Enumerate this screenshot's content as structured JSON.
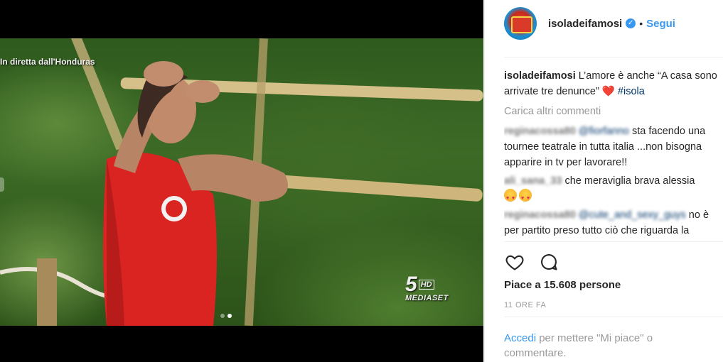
{
  "video": {
    "overlay_text": "In diretta dall'Honduras",
    "logo_number": "5",
    "logo_hd": "HD",
    "logo_name": "MEDIASET",
    "carousel_active": 2,
    "carousel_total": 2
  },
  "post": {
    "username": "isoladeifamosi",
    "verified": true,
    "separator": "•",
    "follow_label": "Segui",
    "caption_user": "isoladeifamosi",
    "caption_text": "L’amore è anche “A casa sono arrivate tre denunce”",
    "caption_heart": "❤️",
    "caption_hashtag": "#isola",
    "load_more": "Carica altri commenti",
    "comments": [
      {
        "user": "reginacossa80",
        "mention": "@fiorfanno",
        "text": "sta facendo una tournee teatrale in tutta italia ...non bisogna apparire in tv per lavorare!!"
      },
      {
        "user": "ali_sana_33",
        "mention": "",
        "text": "che meraviglia brava alessia"
      },
      {
        "user": "reginacossa80",
        "mention": "@cute_and_sexy_guys",
        "text": "no è per partito preso tutto ciò che riguarda la"
      }
    ],
    "likes_text": "Piace a 15.608 persone",
    "time_text": "11 ORE FA",
    "login_link": "Accedi",
    "login_text": " per mettere \"Mi piace\" o commentare."
  },
  "icons": {
    "like": "heart-outline-icon",
    "comment": "comment-bubble-icon",
    "verified": "verified-badge-icon"
  },
  "colors": {
    "link": "#3897f0",
    "hashtag": "#003569",
    "heart": "#ed4956",
    "muted": "#999999"
  }
}
